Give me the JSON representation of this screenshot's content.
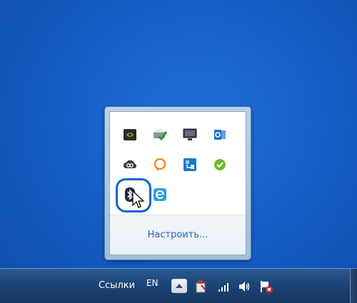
{
  "tray_popup": {
    "customize_label": "Настроить...",
    "icons": [
      {
        "name": "nvidia-icon",
        "color": "#76b900"
      },
      {
        "name": "printer-check-icon",
        "color": "#2e9a3a"
      },
      {
        "name": "display-icon",
        "color": "#4a4a55"
      },
      {
        "name": "outlook-icon",
        "color": "#1f6fcf"
      },
      {
        "name": "creative-cloud-icon",
        "color": "#3a3a3a"
      },
      {
        "name": "chat-bubble-icon",
        "color": "#f28a1c"
      },
      {
        "name": "network-app-icon",
        "color": "#1c78c8"
      },
      {
        "name": "skype-green-icon",
        "color": "#6bbd2a"
      },
      {
        "name": "bluetooth-icon",
        "color": "#1a2a44"
      },
      {
        "name": "ie-icon",
        "color": "#2a9de0"
      }
    ]
  },
  "taskbar": {
    "links_label": "Ссылки",
    "language": "EN",
    "show_hidden_icons": "up-arrow-icon",
    "tray_icons": [
      "safely-remove-icon",
      "signal-icon",
      "volume-icon",
      "action-center-flag-icon"
    ]
  }
}
